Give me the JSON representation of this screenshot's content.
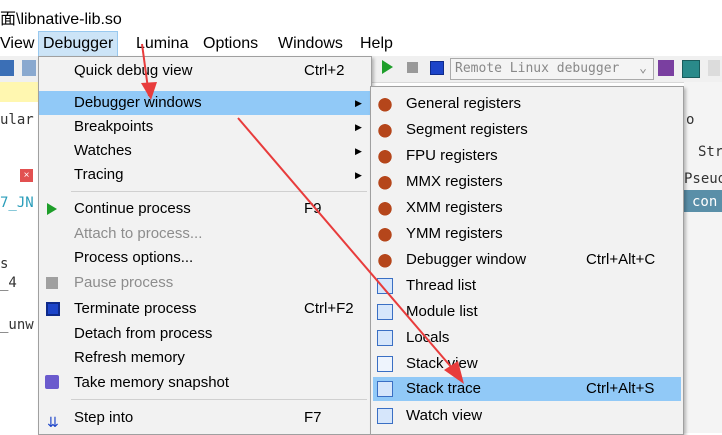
{
  "window": {
    "title": "面\\libnative-lib.so"
  },
  "menubar": [
    {
      "label": "View"
    },
    {
      "label": "Debugger"
    },
    {
      "label": "Lumina"
    },
    {
      "label": "Options"
    },
    {
      "label": "Windows"
    },
    {
      "label": "Help"
    }
  ],
  "toolbar": {
    "debugger_select": "Remote Linux debugger"
  },
  "background_text": {
    "ular": "ular",
    "jn": "7_JN",
    "s": "s",
    "four": "_4",
    "unw": "_unw",
    "right_o": "o",
    "right_str": "Str",
    "right_pseud": "Pseud",
    "right_con": "con"
  },
  "debugger_menu": {
    "items": [
      {
        "label": "Quick debug view",
        "shortcut": "Ctrl+2"
      },
      {
        "label": "Debugger windows",
        "shortcut": ""
      },
      {
        "label": "Breakpoints",
        "shortcut": ""
      },
      {
        "label": "Watches",
        "shortcut": ""
      },
      {
        "label": "Tracing",
        "shortcut": ""
      },
      {
        "label": "Continue process",
        "shortcut": "F9"
      },
      {
        "label": "Attach to process...",
        "shortcut": ""
      },
      {
        "label": "Process options...",
        "shortcut": ""
      },
      {
        "label": "Pause process",
        "shortcut": ""
      },
      {
        "label": "Terminate process",
        "shortcut": "Ctrl+F2"
      },
      {
        "label": "Detach from process",
        "shortcut": ""
      },
      {
        "label": "Refresh memory",
        "shortcut": ""
      },
      {
        "label": "Take memory snapshot",
        "shortcut": ""
      },
      {
        "label": "Step into",
        "shortcut": "F7"
      }
    ]
  },
  "windows_submenu": {
    "items": [
      {
        "label": "General registers",
        "shortcut": ""
      },
      {
        "label": "Segment registers",
        "shortcut": ""
      },
      {
        "label": "FPU registers",
        "shortcut": ""
      },
      {
        "label": "MMX registers",
        "shortcut": ""
      },
      {
        "label": "XMM registers",
        "shortcut": ""
      },
      {
        "label": "YMM registers",
        "shortcut": ""
      },
      {
        "label": "Debugger window",
        "shortcut": "Ctrl+Alt+C"
      },
      {
        "label": "Thread list",
        "shortcut": ""
      },
      {
        "label": "Module list",
        "shortcut": ""
      },
      {
        "label": "Locals",
        "shortcut": ""
      },
      {
        "label": "Stack view",
        "shortcut": ""
      },
      {
        "label": "Stack trace",
        "shortcut": "Ctrl+Alt+S"
      },
      {
        "label": "Watch view",
        "shortcut": ""
      }
    ]
  },
  "colors": {
    "highlight": "#91c9f7",
    "annotation_arrow": "#e83c3c",
    "bug_icon": "#b5461b"
  }
}
